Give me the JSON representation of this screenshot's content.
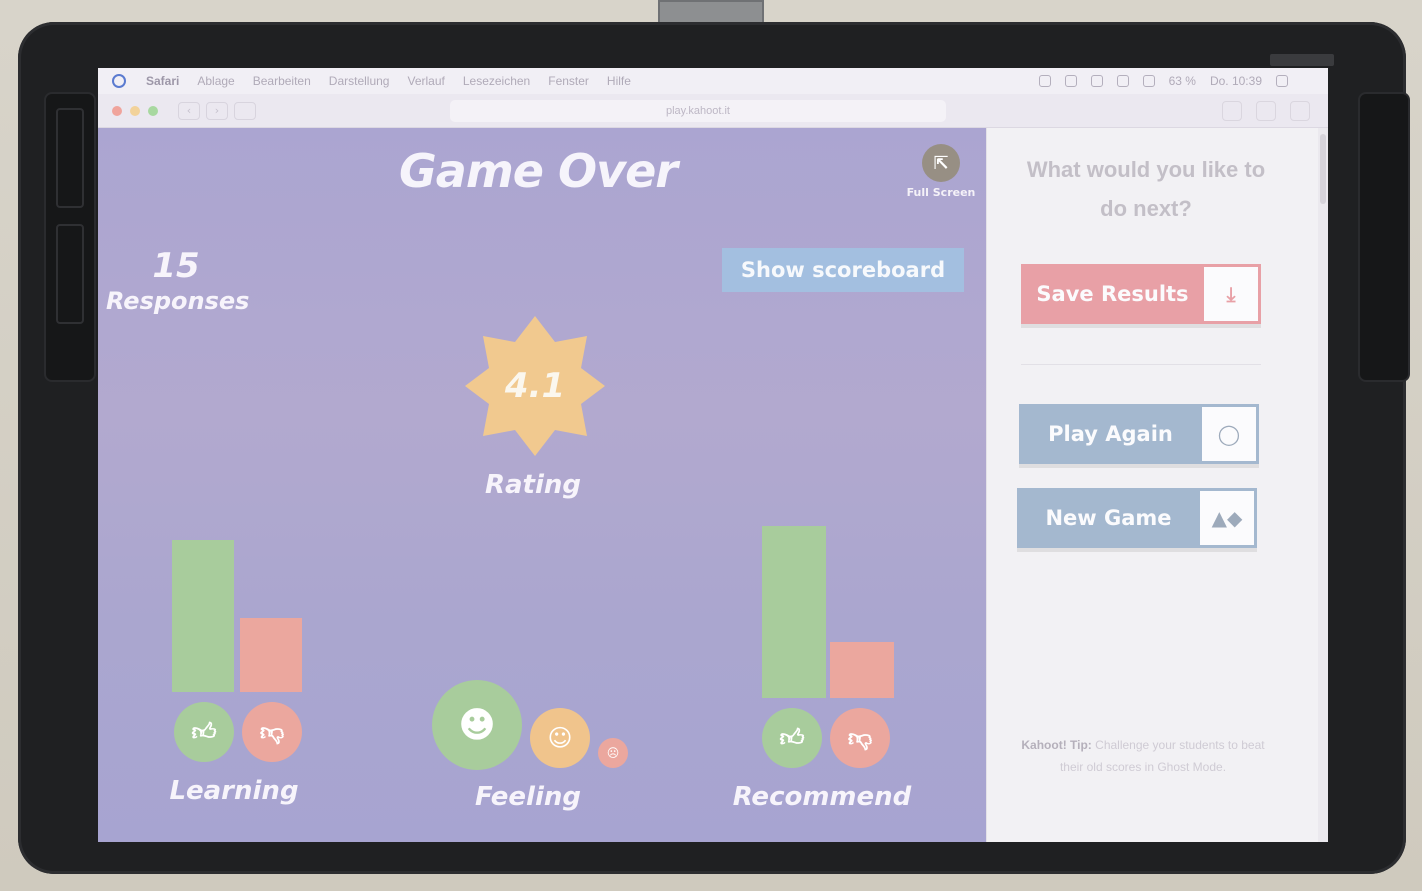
{
  "menubar": {
    "app_name": "Safari",
    "menus": [
      "Ablage",
      "Bearbeiten",
      "Darstellung",
      "Verlauf",
      "Lesezeichen",
      "Fenster",
      "Hilfe"
    ],
    "battery": "63 %",
    "clock": "Do. 10:39"
  },
  "browser": {
    "url": "play.kahoot.it"
  },
  "game": {
    "title": "Game Over",
    "fullscreen_label": "Full Screen",
    "responses_count": "15",
    "responses_label": "Responses",
    "scoreboard_label": "Show scoreboard",
    "rating_value": "4.1",
    "rating_label": "Rating",
    "learning_label": "Learning",
    "feeling_label": "Feeling",
    "recommend_label": "Recommend",
    "colors": {
      "purple_bg": "#aba5d1",
      "green": "#a8cc9c",
      "red": "#eba79e",
      "yellow": "#f0c48c",
      "blue_button": "#a3bfe0"
    }
  },
  "sidebar": {
    "question": "What would you like to do next?",
    "save_label": "Save Results",
    "play_again_label": "Play Again",
    "new_game_label": "New Game",
    "tip_prefix": "Kahoot! Tip:",
    "tip_text": "Challenge your students to beat their old scores in Ghost Mode.",
    "save_color": "#e8a0a6",
    "secondary_color": "#a4b8cf"
  }
}
